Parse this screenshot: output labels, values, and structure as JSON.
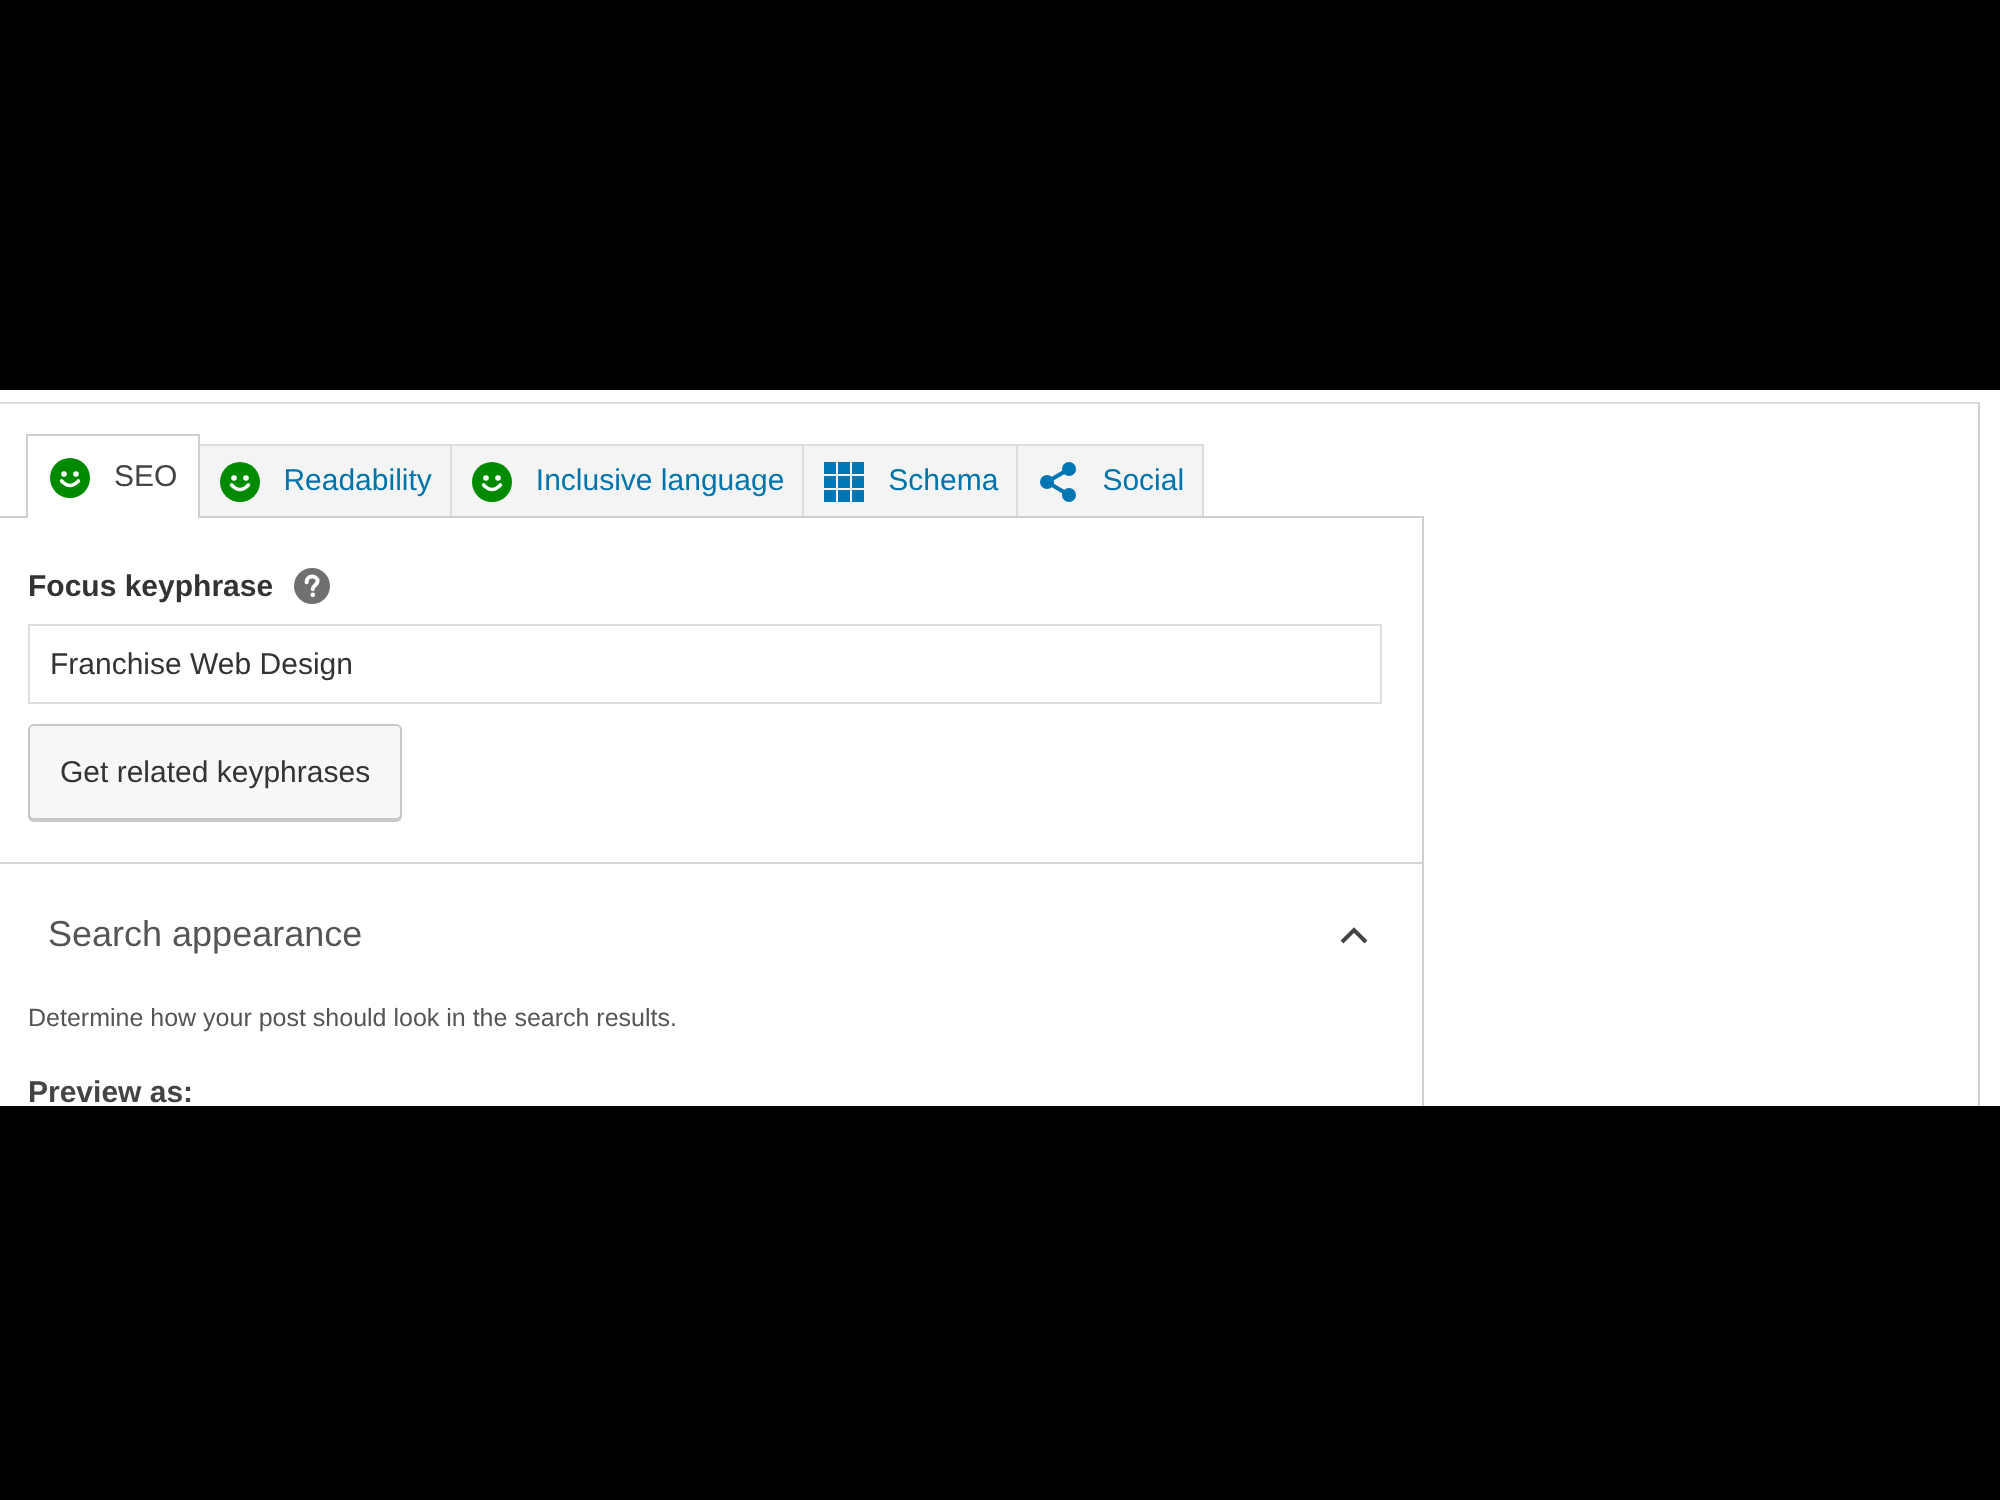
{
  "tabs": [
    {
      "label": "SEO",
      "selected": true,
      "kind": "smiley"
    },
    {
      "label": "Readability",
      "selected": false,
      "kind": "smiley"
    },
    {
      "label": "Inclusive language",
      "selected": false,
      "kind": "smiley"
    },
    {
      "label": "Schema",
      "selected": false,
      "kind": "grid"
    },
    {
      "label": "Social",
      "selected": false,
      "kind": "share"
    }
  ],
  "focus_keyphrase": {
    "label": "Focus keyphrase",
    "value": "Franchise Web Design",
    "button": "Get related keyphrases"
  },
  "search_appearance": {
    "title": "Search appearance",
    "expanded": true,
    "description": "Determine how your post should look in the search results.",
    "preview_label": "Preview as:"
  }
}
